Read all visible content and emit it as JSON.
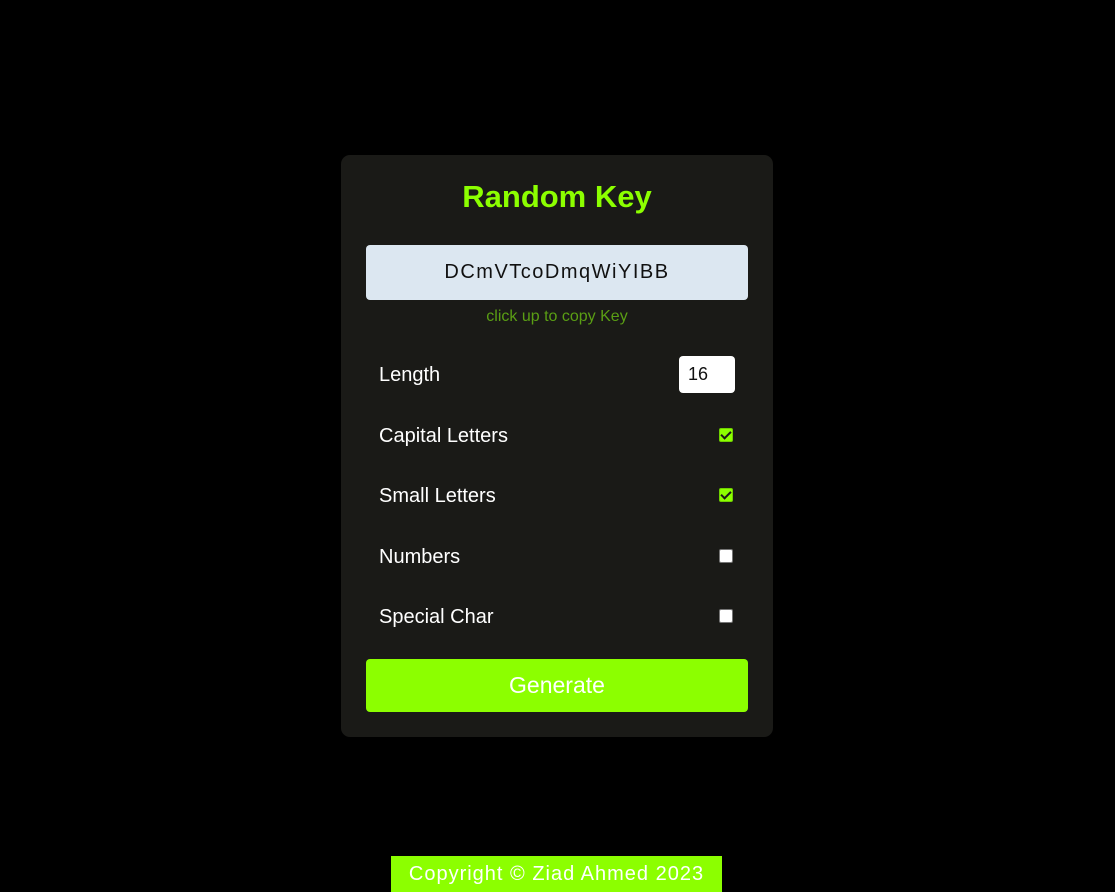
{
  "app": {
    "title": "Random Key",
    "generated_key": "DCmVTcoDmqWiYIBB",
    "copy_hint": "click up to copy Key"
  },
  "options": {
    "length": {
      "label": "Length",
      "value": "16"
    },
    "capital": {
      "label": "Capital Letters",
      "checked": true
    },
    "small": {
      "label": "Small Letters",
      "checked": true
    },
    "numbers": {
      "label": "Numbers",
      "checked": false
    },
    "special": {
      "label": "Special Char",
      "checked": false
    }
  },
  "actions": {
    "generate_label": "Generate"
  },
  "footer": {
    "text": "Copyright © Ziad Ahmed 2023"
  },
  "colors": {
    "accent": "#8cff00",
    "card_bg": "#1a1a17",
    "page_bg": "#000000",
    "key_bg": "#dce7f1",
    "hint": "#5a9e14"
  }
}
